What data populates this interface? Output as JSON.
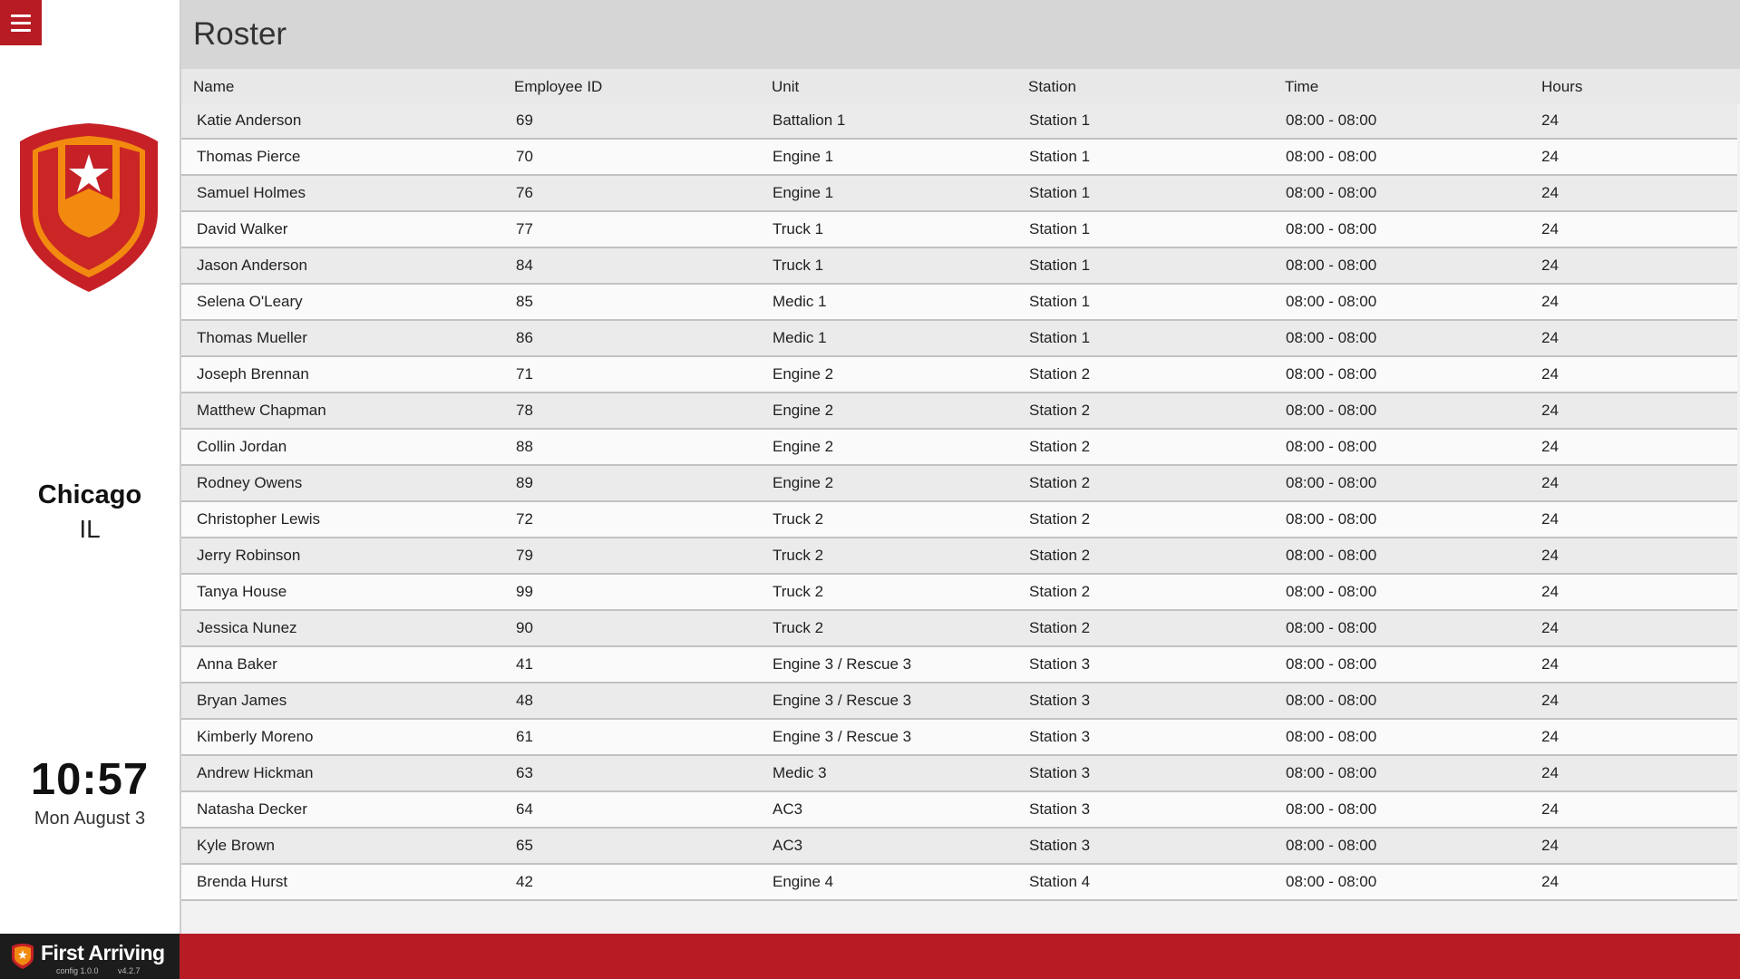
{
  "sidebar": {
    "city": "Chicago",
    "state": "IL",
    "time": "10:57",
    "date": "Mon August 3"
  },
  "page": {
    "title": "Roster"
  },
  "table": {
    "columns": [
      "Name",
      "Employee ID",
      "Unit",
      "Station",
      "Time",
      "Hours"
    ],
    "rows": [
      [
        "Katie Anderson",
        "69",
        "Battalion 1",
        "Station 1",
        "08:00 - 08:00",
        "24"
      ],
      [
        "Thomas Pierce",
        "70",
        "Engine 1",
        "Station 1",
        "08:00 - 08:00",
        "24"
      ],
      [
        "Samuel Holmes",
        "76",
        "Engine 1",
        "Station 1",
        "08:00 - 08:00",
        "24"
      ],
      [
        "David Walker",
        "77",
        "Truck 1",
        "Station 1",
        "08:00 - 08:00",
        "24"
      ],
      [
        "Jason Anderson",
        "84",
        "Truck 1",
        "Station 1",
        "08:00 - 08:00",
        "24"
      ],
      [
        "Selena O'Leary",
        "85",
        "Medic 1",
        "Station 1",
        "08:00 - 08:00",
        "24"
      ],
      [
        "Thomas Mueller",
        "86",
        "Medic 1",
        "Station 1",
        "08:00 - 08:00",
        "24"
      ],
      [
        "Joseph Brennan",
        "71",
        "Engine 2",
        "Station 2",
        "08:00 - 08:00",
        "24"
      ],
      [
        "Matthew Chapman",
        "78",
        "Engine 2",
        "Station 2",
        "08:00 - 08:00",
        "24"
      ],
      [
        "Collin Jordan",
        "88",
        "Engine 2",
        "Station 2",
        "08:00 - 08:00",
        "24"
      ],
      [
        "Rodney Owens",
        "89",
        "Engine 2",
        "Station 2",
        "08:00 - 08:00",
        "24"
      ],
      [
        "Christopher Lewis",
        "72",
        "Truck 2",
        "Station 2",
        "08:00 - 08:00",
        "24"
      ],
      [
        "Jerry Robinson",
        "79",
        "Truck 2",
        "Station 2",
        "08:00 - 08:00",
        "24"
      ],
      [
        "Tanya House",
        "99",
        "Truck 2",
        "Station 2",
        "08:00 - 08:00",
        "24"
      ],
      [
        "Jessica Nunez",
        "90",
        "Truck 2",
        "Station 2",
        "08:00 - 08:00",
        "24"
      ],
      [
        "Anna Baker",
        "41",
        "Engine 3 / Rescue 3",
        "Station 3",
        "08:00 - 08:00",
        "24"
      ],
      [
        "Bryan James",
        "48",
        "Engine 3 / Rescue 3",
        "Station 3",
        "08:00 - 08:00",
        "24"
      ],
      [
        "Kimberly Moreno",
        "61",
        "Engine 3 / Rescue 3",
        "Station 3",
        "08:00 - 08:00",
        "24"
      ],
      [
        "Andrew Hickman",
        "63",
        "Medic 3",
        "Station 3",
        "08:00 - 08:00",
        "24"
      ],
      [
        "Natasha Decker",
        "64",
        "AC3",
        "Station 3",
        "08:00 - 08:00",
        "24"
      ],
      [
        "Kyle Brown",
        "65",
        "AC3",
        "Station 3",
        "08:00 - 08:00",
        "24"
      ],
      [
        "Brenda Hurst",
        "42",
        "Engine 4",
        "Station 4",
        "08:00 - 08:00",
        "24"
      ]
    ]
  },
  "footer": {
    "brand": "First Arriving",
    "config": "config 1.0.0",
    "version": "v4.2.7"
  },
  "colors": {
    "accent": "#b71c24",
    "logo_orange": "#f28a10",
    "logo_red": "#c62127"
  },
  "icons": {
    "menu": "hamburger-menu-icon",
    "logo": "shield-star-logo",
    "brand": "first-arriving-logo-icon"
  }
}
